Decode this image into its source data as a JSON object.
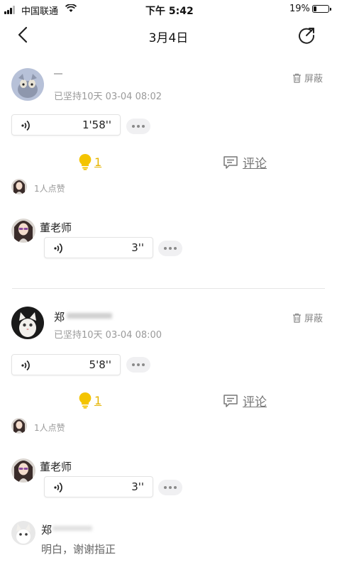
{
  "status_bar": {
    "carrier": "中国联通",
    "time": "下午 5:42",
    "battery": "19%"
  },
  "nav": {
    "title": "3月4日"
  },
  "posts": [
    {
      "user_name": "",
      "meta": "已坚持10天 03-04 08:02",
      "block_label": "屏蔽",
      "voice_duration": "1'58''",
      "like_count": "1",
      "comment_label": "评论",
      "liked_by": "1人点赞",
      "reply": {
        "name": "董老师",
        "voice_duration": "3''"
      }
    },
    {
      "user_name": "郑",
      "meta": "已坚持10天 03-04 08:00",
      "block_label": "屏蔽",
      "voice_duration": "5'8''",
      "like_count": "1",
      "comment_label": "评论",
      "liked_by": "1人点赞",
      "reply": {
        "name": "董老师",
        "voice_duration": "3''"
      },
      "comment": {
        "name": "郑",
        "text": "明白，谢谢指正"
      }
    }
  ],
  "colors": {
    "like": "#e5b400",
    "muted": "#9a9a9a"
  }
}
